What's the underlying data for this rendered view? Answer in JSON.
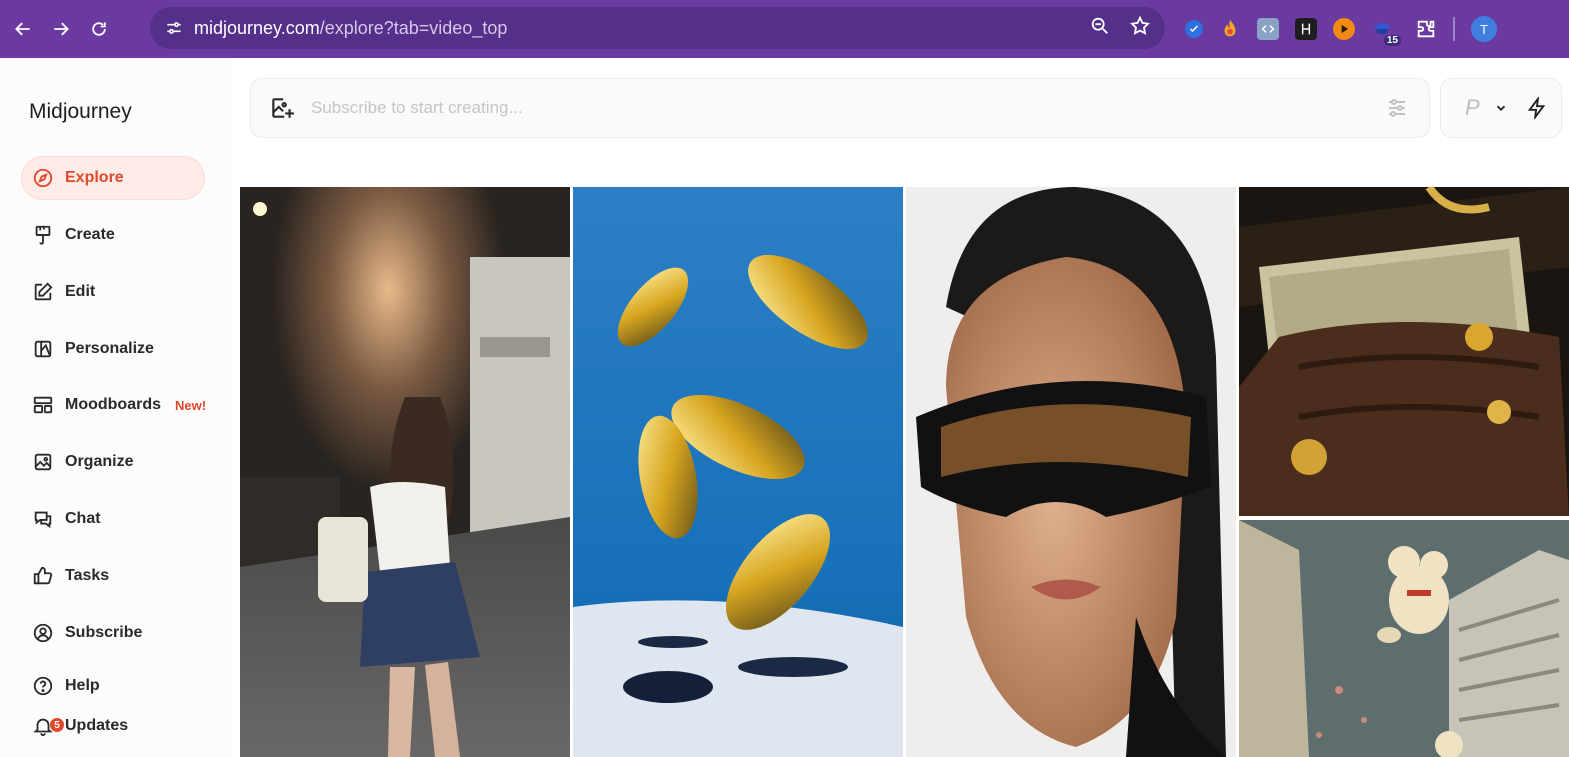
{
  "browser": {
    "url_host": "midjourney.com",
    "url_path": "/explore?tab=video_top",
    "extension_badge": "15",
    "profile_initial": "T"
  },
  "sidebar": {
    "brand": "Midjourney",
    "items": [
      {
        "label": "Explore",
        "icon": "compass-icon"
      },
      {
        "label": "Create",
        "icon": "brush-icon"
      },
      {
        "label": "Edit",
        "icon": "edit-icon"
      },
      {
        "label": "Personalize",
        "icon": "personalize-icon"
      },
      {
        "label": "Moodboards",
        "icon": "moodboard-icon",
        "tag": "New!"
      },
      {
        "label": "Organize",
        "icon": "image-icon"
      },
      {
        "label": "Chat",
        "icon": "chat-icon"
      },
      {
        "label": "Tasks",
        "icon": "thumbs-up-icon"
      },
      {
        "label": "Subscribe",
        "icon": "user-circle-icon"
      },
      {
        "label": "Help",
        "icon": "help-icon"
      },
      {
        "label": "Updates",
        "icon": "bell-icon",
        "badge": "5"
      }
    ]
  },
  "prompt": {
    "placeholder": "Subscribe to start creating...",
    "mode_letter": "P"
  },
  "colors": {
    "browser_bar": "#6a3aa0",
    "accent": "#e0492e"
  }
}
